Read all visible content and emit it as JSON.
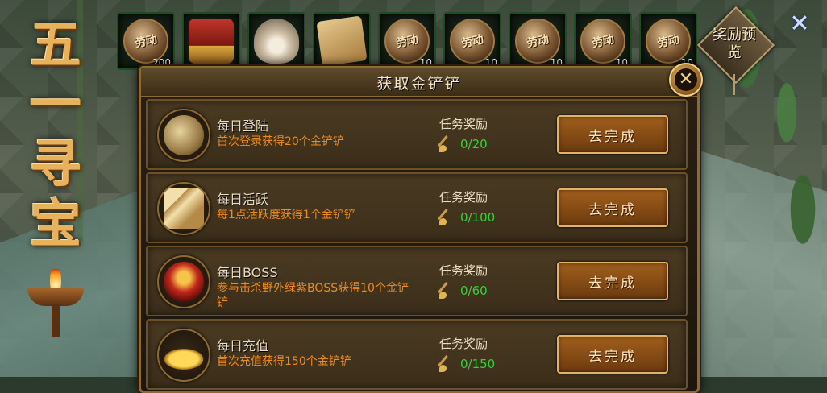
{
  "event": {
    "title_chars": [
      "五",
      "一",
      "寻",
      "宝"
    ]
  },
  "rewards": [
    {
      "icon": "coin-icon",
      "glyph": "劳动",
      "count": "200"
    },
    {
      "icon": "treasure-chest-icon",
      "glyph": "",
      "count": ""
    },
    {
      "icon": "pearl-shell-icon",
      "glyph": "",
      "count": ""
    },
    {
      "icon": "book-icon",
      "glyph": "",
      "count": ""
    },
    {
      "icon": "coin-icon",
      "glyph": "劳动",
      "count": "10"
    },
    {
      "icon": "coin-icon",
      "glyph": "劳动",
      "count": "10"
    },
    {
      "icon": "coin-icon",
      "glyph": "劳动",
      "count": "10"
    },
    {
      "icon": "coin-icon",
      "glyph": "劳动",
      "count": "10"
    },
    {
      "icon": "coin-icon",
      "glyph": "劳动",
      "count": "10"
    }
  ],
  "preview": {
    "label": "奖励预览"
  },
  "top_close": {
    "glyph": "✕"
  },
  "panel": {
    "title": "获取金铲铲",
    "close_glyph": "✕",
    "tasks": [
      {
        "icon": "money-bag-icon",
        "name": "每日登陆",
        "desc": "首次登录获得20个金铲铲",
        "reward_label": "任务奖励",
        "progress": "0/20",
        "button": "去完成"
      },
      {
        "icon": "scroll-icon",
        "name": "每日活跃",
        "desc": "每1点活跃度获得1个金铲铲",
        "reward_label": "任务奖励",
        "progress": "0/100",
        "button": "去完成"
      },
      {
        "icon": "dragon-mask-icon",
        "name": "每日BOSS",
        "desc": "参与击杀野外绿紫BOSS获得10个金铲铲",
        "reward_label": "任务奖励",
        "progress": "0/60",
        "button": "去完成"
      },
      {
        "icon": "gold-ingot-icon",
        "name": "每日充值",
        "desc": "首次充值获得150个金铲铲",
        "reward_label": "任务奖励",
        "progress": "0/150",
        "button": "去完成"
      }
    ]
  },
  "colors": {
    "accent_orange": "#f08a1c",
    "progress_green": "#35d13c",
    "gold_border": "#8b6a36"
  }
}
